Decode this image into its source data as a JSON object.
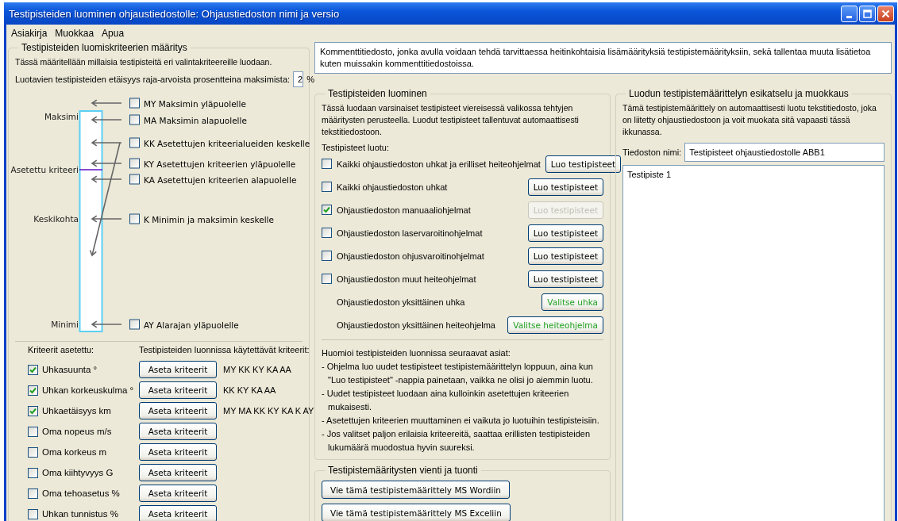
{
  "window": {
    "title": "Testipisteiden luominen ohjaustiedostolle:  Ohjaustiedoston nimi ja versio"
  },
  "menu": [
    {
      "label": "Asiakirja"
    },
    {
      "label": "Muokkaa"
    },
    {
      "label": "Apua"
    }
  ],
  "criteria_panel": {
    "title": "Testipisteiden luomiskriteerien määritys",
    "description": "Tässä määritellään millaisia testipisteitä eri valintakriteereille luodaan.",
    "distance_label": "Luotavien testipisteiden etäisyys raja-arvoista prosentteina maksimista:",
    "distance_value": "2",
    "distance_unit": "%",
    "diagram_labels": [
      "Maksimi",
      "Asetettu kriteeri",
      "Keskikohta",
      "Minimi"
    ],
    "options": [
      {
        "label": "MY Maksimin yläpuolelle",
        "checked": false
      },
      {
        "label": "MA Maksimin alapuolelle",
        "checked": false
      },
      {
        "label": "KK Asetettujen kriteerialueiden keskelle",
        "checked": false
      },
      {
        "label": "KY Asetettujen kriteerien yläpuolelle",
        "checked": false
      },
      {
        "label": "KA Asetettujen kriteerien alapuolelle",
        "checked": false
      },
      {
        "label": "K Minimin ja maksimin keskelle",
        "checked": false
      },
      {
        "label": "AY Alarajan yläpuolelle",
        "checked": false
      }
    ],
    "criteria_header": "Kriteerit asetettu:",
    "used_header": "Testipisteiden luonnissa käytettävät kriteerit:",
    "criteria": [
      {
        "label": "Uhkasuunta °",
        "checked": true,
        "button": "Aseta kriteerit",
        "used": "MY KK KY KA AA"
      },
      {
        "label": "Uhkan korkeuskulma °",
        "checked": true,
        "button": "Aseta kriteerit",
        "used": "KK KY KA AA"
      },
      {
        "label": "Uhkaetäisyys km",
        "checked": true,
        "button": "Aseta kriteerit",
        "used": "MY MA KK KY KA K AY"
      },
      {
        "label": "Oma nopeus m/s",
        "checked": false,
        "button": "Aseta kriteerit"
      },
      {
        "label": "Oma korkeus m",
        "checked": false,
        "button": "Aseta kriteerit"
      },
      {
        "label": "Oma kiihtyvyys G",
        "checked": false,
        "button": "Aseta kriteerit"
      },
      {
        "label": "Oma tehoasetus %",
        "checked": false,
        "button": "Aseta kriteerit"
      },
      {
        "label": "Uhkan tunnistus %",
        "checked": false,
        "button": "Aseta kriteerit"
      }
    ]
  },
  "comment": {
    "text": "Kommenttitiedosto, jonka avulla voidaan tehdä tarvittaessa heitinkohtaisia lisämäärityksiä testipistemäärityksiin, sekä tallentaa muuta lisätietoa\nkuten muissakin kommenttitiedostoissa."
  },
  "creation": {
    "title": "Testipisteiden luominen",
    "description": "Tässä luodaan varsinaiset testipisteet viereisessä valikossa tehtyjen määritysten perusteella. Luodut testipisteet tallentuvat automaattisesti tekstitiedostoon.",
    "created_label": "Testipisteet luotu:",
    "rows": [
      {
        "kind": "checkbox",
        "label": "Kaikki ohjaustiedoston uhkat ja erilliset heiteohjelmat",
        "checked": false,
        "button": "Luo testipisteet",
        "disabled": false
      },
      {
        "kind": "checkbox",
        "label": "Kaikki ohjaustiedoston uhkat",
        "checked": false,
        "button": "Luo testipisteet",
        "disabled": false
      },
      {
        "kind": "checkbox",
        "label": "Ohjaustiedoston manuaaliohjelmat",
        "checked": true,
        "button": "Luo testipisteet",
        "disabled": true
      },
      {
        "kind": "checkbox",
        "label": "Ohjaustiedoston laservaroitinohjelmat",
        "checked": false,
        "button": "Luo testipisteet",
        "disabled": false
      },
      {
        "kind": "checkbox",
        "label": "Ohjaustiedoston ohjusvaroitinohjelmat",
        "checked": false,
        "button": "Luo testipisteet",
        "disabled": false
      },
      {
        "kind": "checkbox",
        "label": "Ohjaustiedoston muut heiteohjelmat",
        "checked": false,
        "button": "Luo testipisteet",
        "disabled": false
      },
      {
        "kind": "select",
        "label": "Ohjaustiedoston yksittäinen uhka",
        "button": "Valitse uhka"
      },
      {
        "kind": "select",
        "label": "Ohjaustiedoston yksittäinen heiteohjelma",
        "button": "Valitse heiteohjelma"
      }
    ],
    "notes_title": "Huomioi testipisteiden luonnissa seuraavat asiat:",
    "notes": [
      "- Ohjelma luo uudet testipisteet testipistemäärittelyn loppuun, aina kun \"Luo testipisteet\" -nappia painetaan, vaikka ne olisi jo aiemmin luotu.",
      "- Uudet testipisteet luodaan aina kulloinkin asetettujen kriteerien mukaisesti.",
      "- Asetettujen kriteerien muuttaminen ei vaikuta jo luotuihin testipisteisiin.",
      "- Jos valitset paljon erilaisia kriteereitä, saattaa erillisten testipisteiden lukumäärä muodostua hyvin suureksi."
    ]
  },
  "export": {
    "title": "Testipistemääritysten vienti ja tuonti",
    "buttons": [
      "Vie tämä testipistemäärittely MS Wordiin",
      "Vie tämä testipistemäärittely MS Exceliin"
    ]
  },
  "preview": {
    "title": "Luodun testipistemäärittelyn esikatselu ja muokkaus",
    "description": "Tämä testipistemäärittely on automaattisesti luotu tekstitiedosto, joka on liitetty ohjaustiedostoon ja voit muokata sitä vapaasti tässä ikkunassa.",
    "filename_label": "Tiedoston nimi:",
    "filename": "Testipisteet ohjaustiedostolle ABB1",
    "content": "Testipiste 1"
  }
}
